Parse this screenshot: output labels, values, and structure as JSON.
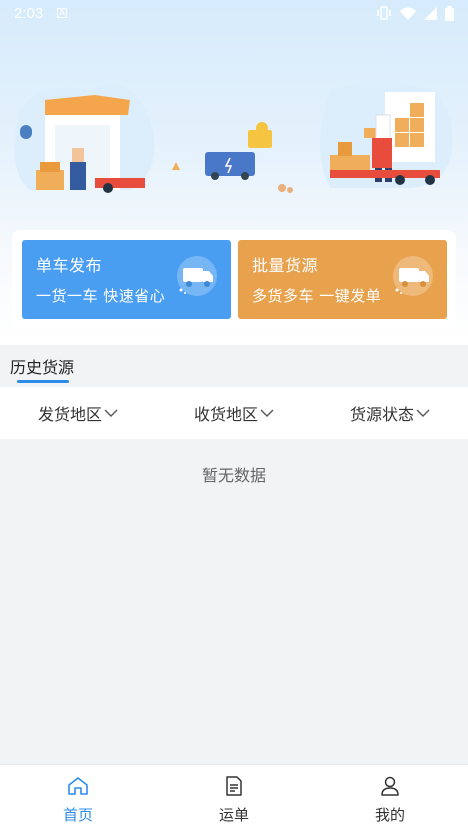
{
  "status_bar": {
    "time": "2:03",
    "notification_icon": "a-app-icon",
    "icons": [
      "vibrate-icon",
      "wifi-icon",
      "signal-icon",
      "battery-icon"
    ]
  },
  "banner": {
    "illustration": "warehouse-and-delivery-truck-illustration"
  },
  "actions": [
    {
      "title": "单车发布",
      "subtitle": "一货一车 快速省心",
      "icon": "truck-icon",
      "color": "#4a9ef2"
    },
    {
      "title": "批量货源",
      "subtitle": "多货多车 一键发单",
      "icon": "truck-icon",
      "color": "#e8a24e"
    }
  ],
  "history": {
    "title": "历史货源",
    "filters": [
      {
        "label": "发货地区"
      },
      {
        "label": "收货地区"
      },
      {
        "label": "货源状态"
      }
    ],
    "empty_text": "暂无数据"
  },
  "tabbar": {
    "items": [
      {
        "label": "首页",
        "icon": "home-icon",
        "active": true
      },
      {
        "label": "运单",
        "icon": "document-icon",
        "active": false
      },
      {
        "label": "我的",
        "icon": "user-icon",
        "active": false
      }
    ]
  },
  "colors": {
    "accent": "#2d8ce8",
    "blue_card": "#4a9ef2",
    "orange_card": "#e8a24e"
  }
}
